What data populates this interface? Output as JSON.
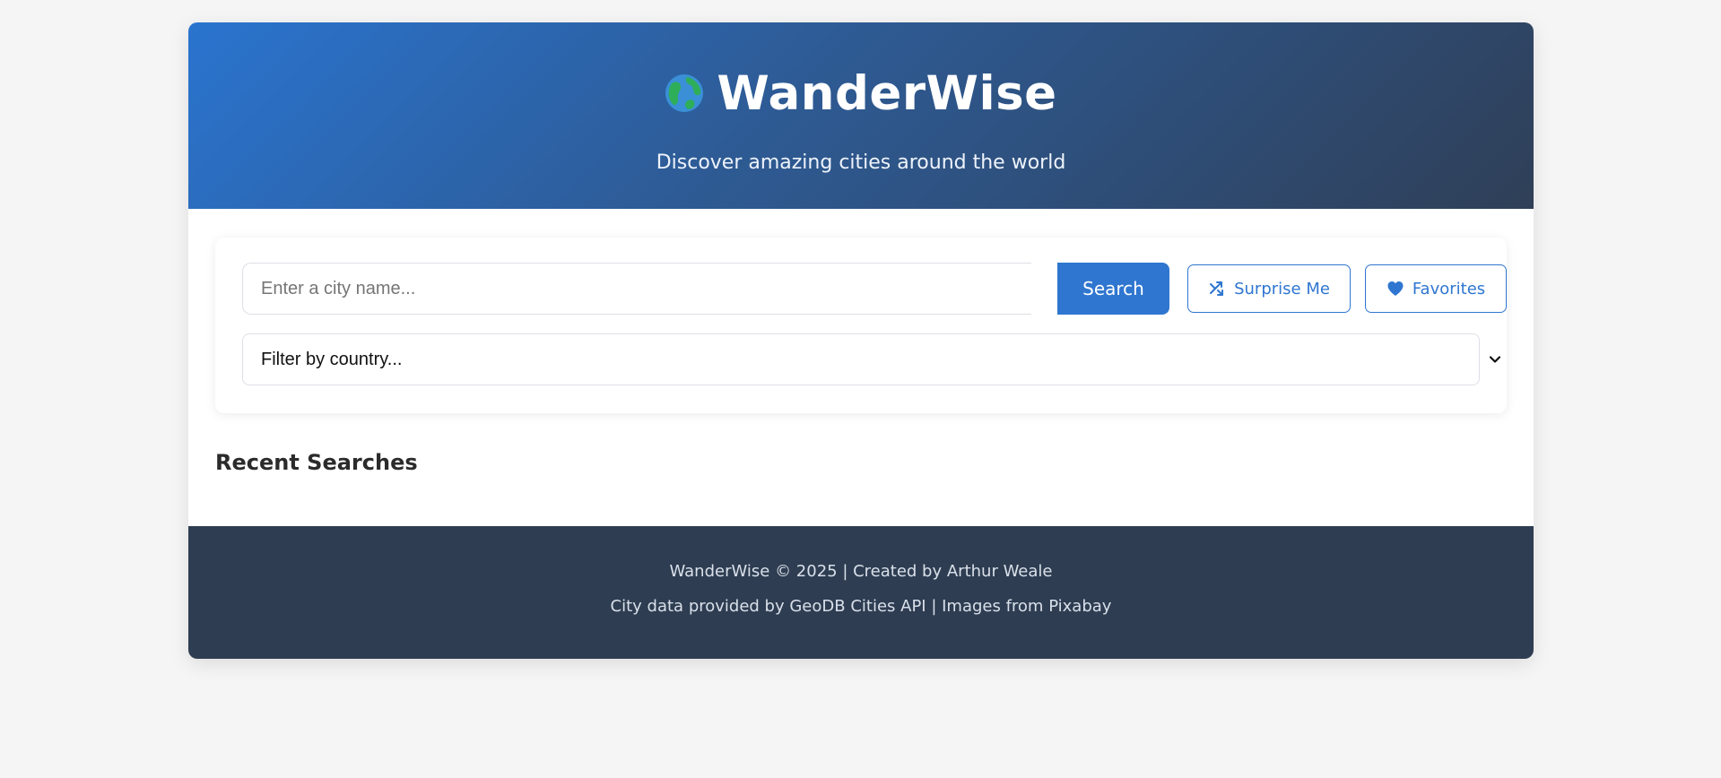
{
  "header": {
    "title": "WanderWise",
    "subtitle": "Discover amazing cities around the world",
    "icon": "globe-icon"
  },
  "search": {
    "placeholder": "Enter a city name...",
    "value": "",
    "search_label": "Search",
    "surprise_label": "Surprise Me",
    "surprise_icon": "shuffle-icon",
    "favorites_label": "Favorites",
    "favorites_icon": "heart-icon",
    "country_filter": {
      "selected": "Filter by country...",
      "options": [
        "Filter by country..."
      ]
    }
  },
  "recent": {
    "title": "Recent Searches",
    "items": []
  },
  "footer": {
    "line1": "WanderWise © 2025 | Created by Arthur Weale",
    "line2": "City data provided by GeoDB Cities API | Images from Pixabay"
  },
  "colors": {
    "accent": "#2f76d0",
    "header_gradient_start": "#2a74cf",
    "header_gradient_end": "#2f3f57",
    "footer_bg": "#2e3d51",
    "page_bg": "#f5f5f5"
  }
}
